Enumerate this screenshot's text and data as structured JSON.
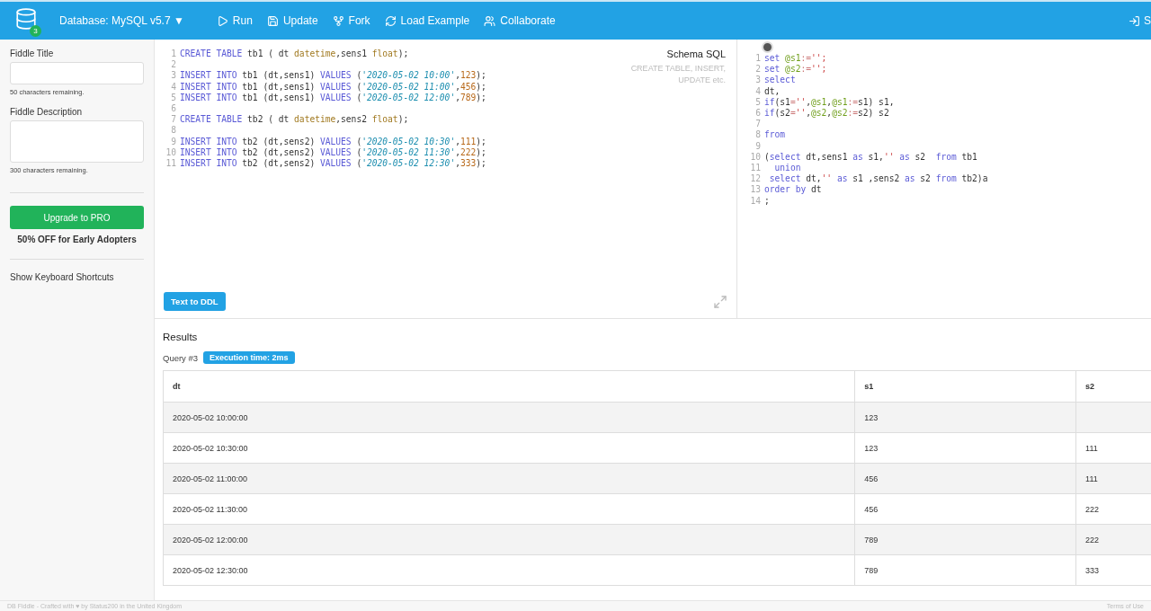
{
  "header": {
    "database_label": "Database: MySQL v5.7",
    "database_caret": "▼",
    "badge": "3",
    "actions": [
      {
        "kind": "run",
        "label": "Run"
      },
      {
        "kind": "update",
        "label": "Update"
      },
      {
        "kind": "fork",
        "label": "Fork"
      },
      {
        "kind": "load",
        "label": "Load Example"
      },
      {
        "kind": "collaborate",
        "label": "Collaborate"
      }
    ],
    "sign_in": "S"
  },
  "sidebar": {
    "title_label": "Fiddle Title",
    "title_hint": "50 characters remaining.",
    "description_label": "Fiddle Description",
    "description_hint": "300 characters remaining.",
    "upgrade_button": "Upgrade to PRO",
    "offer": "50% OFF for Early Adopters",
    "shortcuts_link": "Show Keyboard Shortcuts"
  },
  "schema_panel": {
    "title": "Schema SQL",
    "subtitle": "CREATE TABLE, INSERT, UPDATE etc.",
    "text_to_ddl_button": "Text to DDL",
    "lines": [
      {
        "number": "1",
        "segments": [
          {
            "kind": "keyword",
            "text": "CREATE TABLE"
          },
          {
            "kind": "plain",
            "text": " tb1 ( dt "
          },
          {
            "kind": "type",
            "text": "datetime"
          },
          {
            "kind": "plain",
            "text": ",sens1 "
          },
          {
            "kind": "type",
            "text": "float"
          },
          {
            "kind": "plain",
            "text": ");"
          }
        ]
      },
      {
        "number": "2"
      },
      {
        "number": "3",
        "segments": [
          {
            "kind": "keyword",
            "text": "INSERT INTO"
          },
          {
            "kind": "plain",
            "text": " tb1 (dt,sens1) "
          },
          {
            "kind": "keyword",
            "text": "VALUES"
          },
          {
            "kind": "plain",
            "text": " ("
          },
          {
            "kind": "string",
            "text": "'2020-05-02 10:00'"
          },
          {
            "kind": "plain",
            "text": ","
          },
          {
            "kind": "number",
            "text": "123"
          },
          {
            "kind": "plain",
            "text": ");"
          }
        ]
      },
      {
        "number": "4",
        "segments": [
          {
            "kind": "keyword",
            "text": "INSERT INTO"
          },
          {
            "kind": "plain",
            "text": " tb1 (dt,sens1) "
          },
          {
            "kind": "keyword",
            "text": "VALUES"
          },
          {
            "kind": "plain",
            "text": " ("
          },
          {
            "kind": "string",
            "text": "'2020-05-02 11:00'"
          },
          {
            "kind": "plain",
            "text": ","
          },
          {
            "kind": "number",
            "text": "456"
          },
          {
            "kind": "plain",
            "text": ");"
          }
        ]
      },
      {
        "number": "5",
        "segments": [
          {
            "kind": "keyword",
            "text": "INSERT INTO"
          },
          {
            "kind": "plain",
            "text": " tb1 (dt,sens1) "
          },
          {
            "kind": "keyword",
            "text": "VALUES"
          },
          {
            "kind": "plain",
            "text": " ("
          },
          {
            "kind": "string",
            "text": "'2020-05-02 12:00'"
          },
          {
            "kind": "plain",
            "text": ","
          },
          {
            "kind": "number",
            "text": "789"
          },
          {
            "kind": "plain",
            "text": ");"
          }
        ]
      },
      {
        "number": "6"
      },
      {
        "number": "7",
        "segments": [
          {
            "kind": "keyword",
            "text": "CREATE TABLE"
          },
          {
            "kind": "plain",
            "text": " tb2 ( dt "
          },
          {
            "kind": "type",
            "text": "datetime"
          },
          {
            "kind": "plain",
            "text": ",sens2 "
          },
          {
            "kind": "type",
            "text": "float"
          },
          {
            "kind": "plain",
            "text": ");"
          }
        ]
      },
      {
        "number": "8"
      },
      {
        "number": "9",
        "segments": [
          {
            "kind": "keyword",
            "text": "INSERT INTO"
          },
          {
            "kind": "plain",
            "text": " tb2 (dt,sens2) "
          },
          {
            "kind": "keyword",
            "text": "VALUES"
          },
          {
            "kind": "plain",
            "text": " ("
          },
          {
            "kind": "string",
            "text": "'2020-05-02 10:30'"
          },
          {
            "kind": "plain",
            "text": ","
          },
          {
            "kind": "number",
            "text": "111"
          },
          {
            "kind": "plain",
            "text": ");"
          }
        ]
      },
      {
        "number": "10",
        "segments": [
          {
            "kind": "keyword",
            "text": "INSERT INTO"
          },
          {
            "kind": "plain",
            "text": " tb2 (dt,sens2) "
          },
          {
            "kind": "keyword",
            "text": "VALUES"
          },
          {
            "kind": "plain",
            "text": " ("
          },
          {
            "kind": "string",
            "text": "'2020-05-02 11:30'"
          },
          {
            "kind": "plain",
            "text": ","
          },
          {
            "kind": "number",
            "text": "222"
          },
          {
            "kind": "plain",
            "text": ");"
          }
        ]
      },
      {
        "number": "11",
        "segments": [
          {
            "kind": "keyword",
            "text": "INSERT INTO"
          },
          {
            "kind": "plain",
            "text": " tb2 (dt,sens2) "
          },
          {
            "kind": "keyword",
            "text": "VALUES"
          },
          {
            "kind": "plain",
            "text": " ("
          },
          {
            "kind": "string",
            "text": "'2020-05-02 12:30'"
          },
          {
            "kind": "plain",
            "text": ","
          },
          {
            "kind": "number",
            "text": "333"
          },
          {
            "kind": "plain",
            "text": ");"
          }
        ]
      }
    ]
  },
  "query_panel": {
    "lines": [
      {
        "number": "1",
        "segments": [
          {
            "kind": "keyword",
            "text": "set "
          },
          {
            "kind": "variable",
            "text": "@s1"
          },
          {
            "kind": "operator",
            "text": ":="
          },
          {
            "kind": "quote",
            "text": "'';"
          }
        ]
      },
      {
        "number": "2",
        "segments": [
          {
            "kind": "keyword",
            "text": "set "
          },
          {
            "kind": "variable",
            "text": "@s2"
          },
          {
            "kind": "operator",
            "text": ":="
          },
          {
            "kind": "quote",
            "text": "'';"
          }
        ]
      },
      {
        "number": "3",
        "segments": [
          {
            "kind": "keyword",
            "text": "select"
          }
        ]
      },
      {
        "number": "4",
        "segments": [
          {
            "kind": "plain",
            "text": "dt,"
          }
        ]
      },
      {
        "number": "5",
        "segments": [
          {
            "kind": "keyword",
            "text": "if"
          },
          {
            "kind": "plain",
            "text": "(s1"
          },
          {
            "kind": "operator",
            "text": "="
          },
          {
            "kind": "quote",
            "text": "''"
          },
          {
            "kind": "plain",
            "text": ","
          },
          {
            "kind": "variable",
            "text": "@s1"
          },
          {
            "kind": "plain",
            "text": ","
          },
          {
            "kind": "variable",
            "text": "@s1"
          },
          {
            "kind": "operator",
            "text": ":="
          },
          {
            "kind": "plain",
            "text": "s1) s1,"
          }
        ]
      },
      {
        "number": "6",
        "segments": [
          {
            "kind": "keyword",
            "text": "if"
          },
          {
            "kind": "plain",
            "text": "(s2"
          },
          {
            "kind": "operator",
            "text": "="
          },
          {
            "kind": "quote",
            "text": "''"
          },
          {
            "kind": "plain",
            "text": ","
          },
          {
            "kind": "variable",
            "text": "@s2"
          },
          {
            "kind": "plain",
            "text": ","
          },
          {
            "kind": "variable",
            "text": "@s2"
          },
          {
            "kind": "operator",
            "text": ":="
          },
          {
            "kind": "plain",
            "text": "s2) s2"
          }
        ]
      },
      {
        "number": "7"
      },
      {
        "number": "8",
        "segments": [
          {
            "kind": "keyword",
            "text": "from"
          }
        ]
      },
      {
        "number": "9"
      },
      {
        "number": "10",
        "segments": [
          {
            "kind": "plain",
            "text": "("
          },
          {
            "kind": "keyword",
            "text": "select"
          },
          {
            "kind": "plain",
            "text": " dt,sens1 "
          },
          {
            "kind": "keyword",
            "text": "as"
          },
          {
            "kind": "plain",
            "text": " s1,"
          },
          {
            "kind": "quote",
            "text": "'' "
          },
          {
            "kind": "keyword",
            "text": "as"
          },
          {
            "kind": "plain",
            "text": " s2  "
          },
          {
            "kind": "keyword",
            "text": "from"
          },
          {
            "kind": "plain",
            "text": " tb1"
          }
        ]
      },
      {
        "number": "11",
        "segments": [
          {
            "kind": "keyword",
            "text": "  union"
          }
        ]
      },
      {
        "number": "12",
        "segments": [
          {
            "kind": "keyword",
            "text": " select"
          },
          {
            "kind": "plain",
            "text": " dt,"
          },
          {
            "kind": "quote",
            "text": "'' "
          },
          {
            "kind": "keyword",
            "text": "as"
          },
          {
            "kind": "plain",
            "text": " s1 ,sens2 "
          },
          {
            "kind": "keyword",
            "text": "as"
          },
          {
            "kind": "plain",
            "text": " s2 "
          },
          {
            "kind": "keyword",
            "text": "from"
          },
          {
            "kind": "plain",
            "text": " tb2)a"
          }
        ]
      },
      {
        "number": "13",
        "segments": [
          {
            "kind": "keyword",
            "text": "order by"
          },
          {
            "kind": "plain",
            "text": " dt"
          }
        ]
      },
      {
        "number": "14",
        "segments": [
          {
            "kind": "plain",
            "text": ";"
          }
        ]
      }
    ]
  },
  "results": {
    "title": "Results",
    "query_label": "Query #3",
    "execution_badge": "Execution time: 2ms",
    "columns": [
      "dt",
      "s1",
      "s2"
    ],
    "rows": [
      [
        "2020-05-02 10:00:00",
        "123",
        null
      ],
      [
        "2020-05-02 10:30:00",
        "123",
        "111"
      ],
      [
        "2020-05-02 11:00:00",
        "456",
        "111"
      ],
      [
        "2020-05-02 11:30:00",
        "456",
        "222"
      ],
      [
        "2020-05-02 12:00:00",
        "789",
        "222"
      ],
      [
        "2020-05-02 12:30:00",
        "789",
        "333"
      ]
    ]
  },
  "footer": {
    "credit": "DB Fiddle - Crafted with ♥ by Status200 in the United Kingdom",
    "terms": "Terms of Use"
  }
}
